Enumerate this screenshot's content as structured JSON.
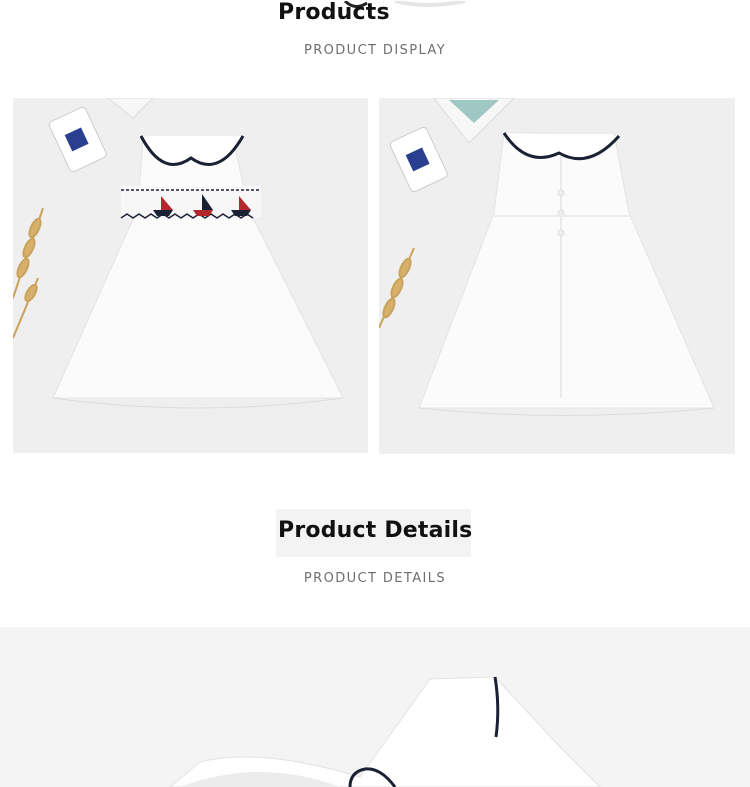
{
  "products_section": {
    "title": "Products",
    "subtitle": "PRODUCT DISPLAY"
  },
  "details_section": {
    "title": "Product Details",
    "subtitle": "PRODUCT DETAILS"
  },
  "photos": [
    {
      "name": "front"
    },
    {
      "name": "back"
    }
  ],
  "colors": {
    "navy_trim": "#1b2135",
    "dress_white": "#fbfbfb",
    "background": "#f1f1f1",
    "wheat": "#c9a25c",
    "red_boat": "#b3262d"
  }
}
